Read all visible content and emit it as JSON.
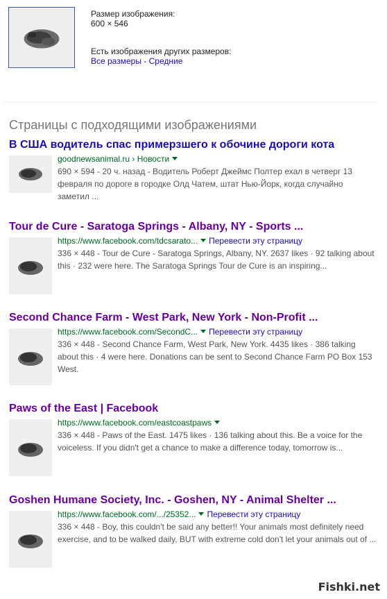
{
  "image_info": {
    "size_label": "Размер изображения:",
    "size_value": "600 × 546",
    "other_sizes_label": "Есть изображения других размеров:",
    "all_sizes_link": "Все размеры",
    "separator": " - ",
    "medium_link": "Средние"
  },
  "section_title": "Страницы с подходящими изображениями",
  "results": [
    {
      "title": "В США водитель спас примерзшего к обочине дороги кота",
      "url": "goodnewsanimal.ru › Новости",
      "translate": "",
      "snippet": "690 × 594 - 20 ч. назад - Водитель Роберт Джеймс Полтер ехал в четверг 13 февраля по дороге в городке Олд Чатем, штат Нью-Йорк, когда случайно заметил ..."
    },
    {
      "title": "Tour de Cure - Saratoga Springs - Albany, NY - Sports ...",
      "url": "https://www.facebook.com/tdcsarato...",
      "translate": "Перевести эту страницу",
      "snippet": "336 × 448 - Tour de Cure - Saratoga Springs, Albany, NY. 2637 likes · 92 talking about this · 232 were here. The Saratoga Springs Tour de Cure is an inspiring..."
    },
    {
      "title": "Second Chance Farm - West Park, New York - Non-Profit ...",
      "url": "https://www.facebook.com/SecondC...",
      "translate": "Перевести эту страницу",
      "snippet": "336 × 448 - Second Chance Farm, West Park, New York. 4435 likes · 386 talking about this · 4 were here. Donations can be sent to Second Chance Farm PO Box 153 West."
    },
    {
      "title": "Paws of the East | Facebook",
      "url": "https://www.facebook.com/eastcoastpaws",
      "translate": "",
      "snippet": "336 × 448 - Paws of the East. 1475 likes · 136 talking about this. Be a voice for the voiceless. If you didn't get a chance to make a difference today, tomorrow is..."
    },
    {
      "title": "Goshen Humane Society, Inc. - Goshen, NY - Animal Shelter ...",
      "url": "https://www.facebook.com/.../25352...",
      "translate": "Перевести эту страницу",
      "snippet": "336 × 448 - Boy, this couldn't be said any better!! Your animals most definitely need exercise, and to be walked daily, BUT with extreme cold don't let your animals out of ..."
    }
  ],
  "watermark": "Fishki.net",
  "colors": {
    "link": "#1a0dab",
    "visited": "#660099",
    "url_green": "#006621",
    "snippet": "#545454"
  }
}
